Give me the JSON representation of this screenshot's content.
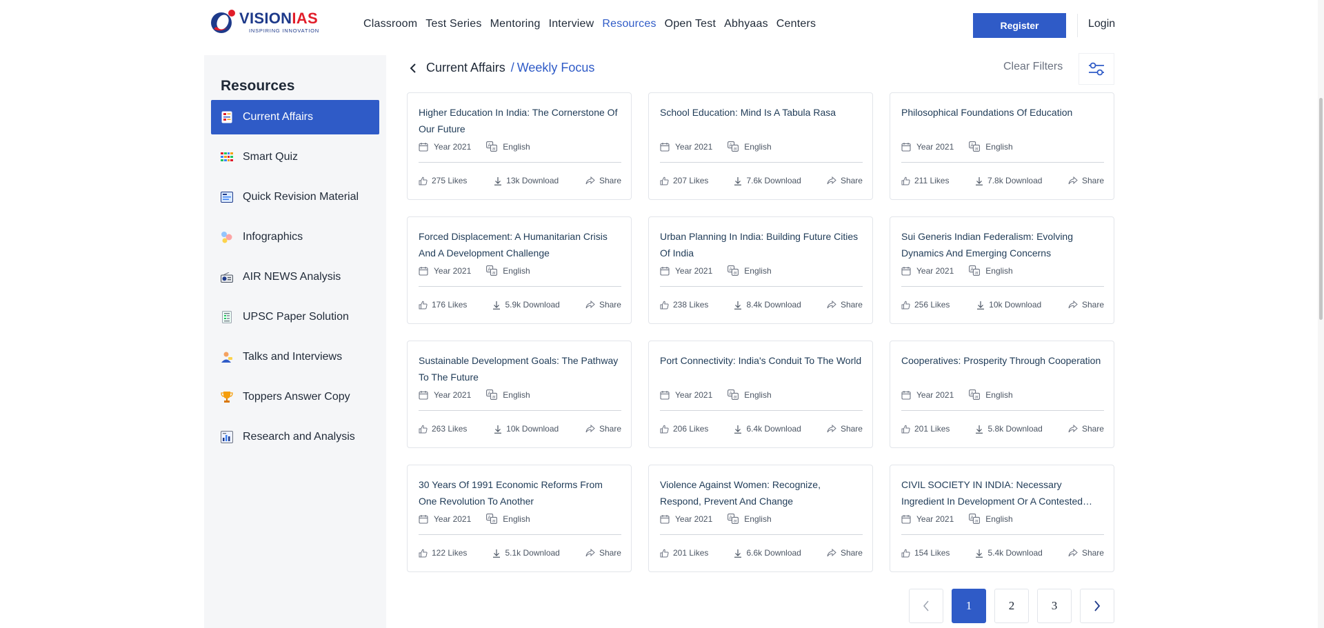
{
  "header": {
    "logo": {
      "main": "VISION",
      "accent": "IAS",
      "tagline": "INSPIRING INNOVATION"
    },
    "nav": [
      {
        "label": "Classroom",
        "active": false
      },
      {
        "label": "Test Series",
        "active": false
      },
      {
        "label": "Mentoring",
        "active": false
      },
      {
        "label": "Interview",
        "active": false
      },
      {
        "label": "Resources",
        "active": true
      },
      {
        "label": "Open Test",
        "active": false
      },
      {
        "label": "Abhyaas",
        "active": false
      },
      {
        "label": "Centers",
        "active": false
      }
    ],
    "register_label": "Register",
    "login_label": "Login"
  },
  "sidebar": {
    "title": "Resources",
    "items": [
      {
        "label": "Current Affairs",
        "icon": "current-affairs-icon",
        "active": true
      },
      {
        "label": "Smart Quiz",
        "icon": "smart-quiz-icon",
        "active": false
      },
      {
        "label": "Quick Revision Material",
        "icon": "quick-revision-icon",
        "active": false
      },
      {
        "label": "Infographics",
        "icon": "infographics-icon",
        "active": false
      },
      {
        "label": "AIR NEWS Analysis",
        "icon": "radio-icon",
        "active": false
      },
      {
        "label": "UPSC Paper Solution",
        "icon": "paper-solution-icon",
        "active": false
      },
      {
        "label": "Talks and Interviews",
        "icon": "talks-icon",
        "active": false
      },
      {
        "label": "Toppers Answer Copy",
        "icon": "trophy-icon",
        "active": false
      },
      {
        "label": "Research and Analysis",
        "icon": "research-chart-icon",
        "active": false
      }
    ]
  },
  "breadcrumb": {
    "parent": "Current Affairs",
    "separator": "/",
    "current": "Weekly Focus"
  },
  "clear_filters_label": "Clear Filters",
  "cards": [
    {
      "title": "Higher Education In India: The Cornerstone Of Our Future",
      "year": "Year 2021",
      "language": "English",
      "likes": "275 Likes",
      "downloads": "13k Download",
      "share": "Share"
    },
    {
      "title": "School Education: Mind Is A Tabula Rasa",
      "year": "Year 2021",
      "language": "English",
      "likes": "207 Likes",
      "downloads": "7.6k Download",
      "share": "Share"
    },
    {
      "title": "Philosophical Foundations Of Education",
      "year": "Year 2021",
      "language": "English",
      "likes": "211 Likes",
      "downloads": "7.8k Download",
      "share": "Share"
    },
    {
      "title": "Forced Displacement: A Humanitarian Crisis And A Development Challenge",
      "year": "Year 2021",
      "language": "English",
      "likes": "176 Likes",
      "downloads": "5.9k Download",
      "share": "Share"
    },
    {
      "title": "Urban Planning In India: Building Future Cities Of India",
      "year": "Year 2021",
      "language": "English",
      "likes": "238 Likes",
      "downloads": "8.4k Download",
      "share": "Share"
    },
    {
      "title": "Sui Generis Indian Federalism: Evolving Dynamics And Emerging Concerns",
      "year": "Year 2021",
      "language": "English",
      "likes": "256 Likes",
      "downloads": "10k Download",
      "share": "Share"
    },
    {
      "title": "Sustainable Development Goals: The Pathway To The Future",
      "year": "Year 2021",
      "language": "English",
      "likes": "263 Likes",
      "downloads": "10k Download",
      "share": "Share"
    },
    {
      "title": "Port Connectivity: India's Conduit To The World",
      "year": "Year 2021",
      "language": "English",
      "likes": "206 Likes",
      "downloads": "6.4k Download",
      "share": "Share"
    },
    {
      "title": "Cooperatives: Prosperity Through Cooperation",
      "year": "Year 2021",
      "language": "English",
      "likes": "201 Likes",
      "downloads": "5.8k Download",
      "share": "Share"
    },
    {
      "title": "30 Years Of 1991 Economic Reforms From One Revolution To Another",
      "year": "Year 2021",
      "language": "English",
      "likes": "122 Likes",
      "downloads": "5.1k Download",
      "share": "Share"
    },
    {
      "title": "Violence Against Women: Recognize, Respond, Prevent And Change",
      "year": "Year 2021",
      "language": "English",
      "likes": "201 Likes",
      "downloads": "6.6k Download",
      "share": "Share"
    },
    {
      "title": "CIVIL SOCIETY IN INDIA: Necessary Ingredient In Development Or A Contested Domain",
      "year": "Year 2021",
      "language": "English",
      "likes": "154 Likes",
      "downloads": "5.4k Download",
      "share": "Share"
    }
  ],
  "pagination": {
    "pages": [
      "1",
      "2",
      "3"
    ],
    "current": "1"
  },
  "colors": {
    "accent": "#2f5bc7",
    "brand_red": "#e11d2a",
    "brand_navy": "#1e3a8a",
    "sidebar_bg": "#f5f6f8"
  }
}
